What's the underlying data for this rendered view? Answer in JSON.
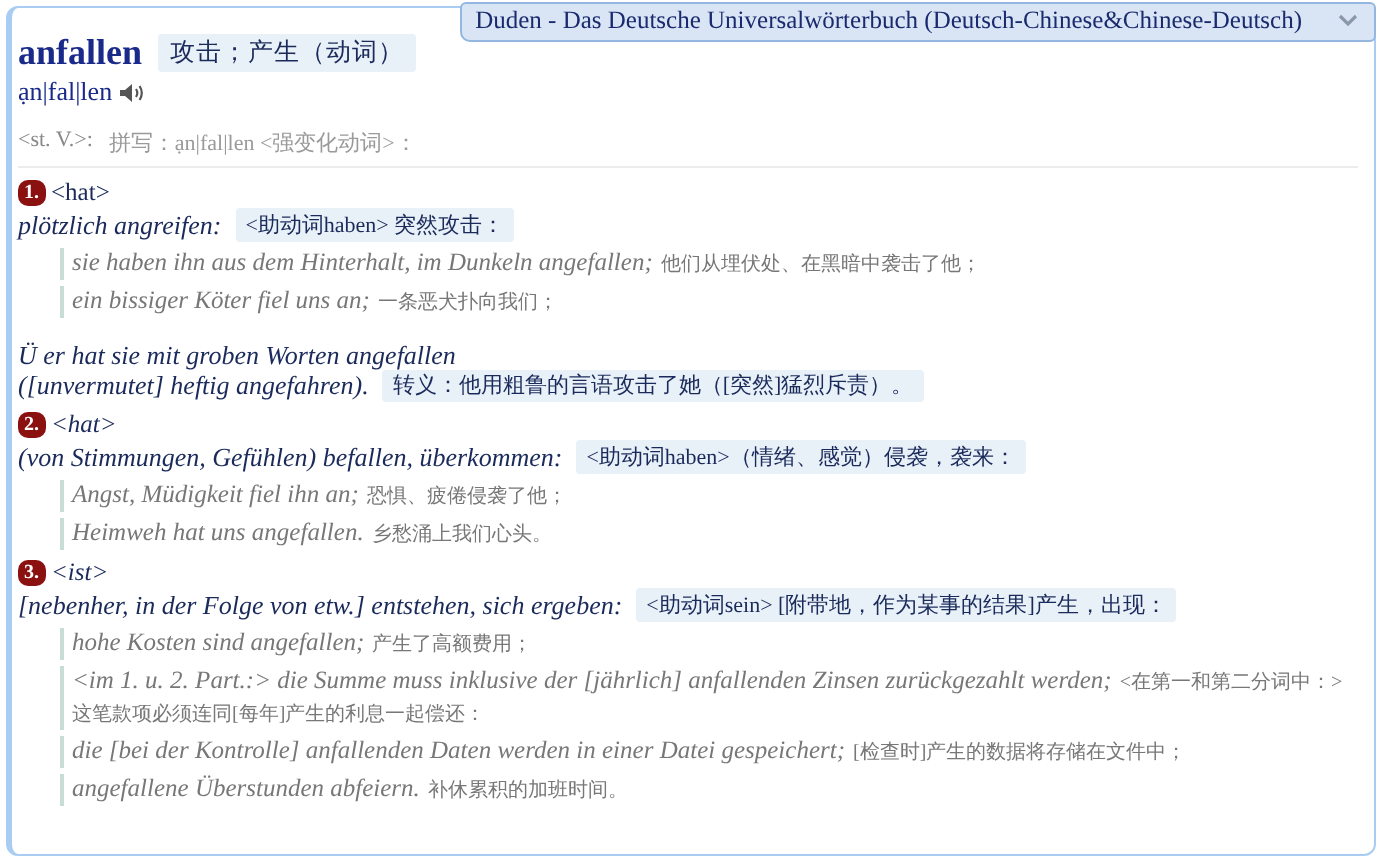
{
  "dictionary_tab": {
    "title": "Duden - Das Deutsche Universalwörterbuch (Deutsch-Chinese&Chinese-Deutsch)"
  },
  "headword": {
    "word": "anfallen",
    "translation": "攻击；产生（动词）",
    "pronunciation": "ạn|fal|len"
  },
  "grammar": {
    "label": "<st. V.>:",
    "spelling": "拼写：ạn|fal|len <强变化动词>："
  },
  "senses": [
    {
      "number": "1.",
      "aux": "<hat>",
      "definition": "plötzlich angreifen:",
      "translation": "<助动词haben> 突然攻击：",
      "examples": [
        {
          "de": "sie haben ihn aus dem Hinterhalt, im Dunkeln angefallen;",
          "zh": "他们从埋伏处、在黑暗中袭击了他；"
        },
        {
          "de": "ein bissiger Köter fiel uns an;",
          "zh": "一条恶犬扑向我们；"
        }
      ],
      "idiom": {
        "lines": [
          "Ü er hat sie mit groben Worten angefallen",
          "([unvermutet] heftig angefahren)."
        ],
        "translation": "转义：他用粗鲁的言语攻击了她（[突然]猛烈斥责）。"
      }
    },
    {
      "number": "2.",
      "aux": "<hat>",
      "definition": "(von Stimmungen, Gefühlen) befallen, überkommen:",
      "translation": "<助动词haben>（情绪、感觉）侵袭，袭来：",
      "examples": [
        {
          "de": "Angst, Müdigkeit fiel ihn an;",
          "zh": "恐惧、疲倦侵袭了他；"
        },
        {
          "de": "Heimweh hat uns angefallen.",
          "zh": "乡愁涌上我们心头。"
        }
      ]
    },
    {
      "number": "3.",
      "aux": "<ist>",
      "definition": "[nebenher, in der Folge von etw.] entstehen, sich ergeben:",
      "translation": "<助动词sein> [附带地，作为某事的结果]产生，出现：",
      "examples": [
        {
          "de": "hohe Kosten sind angefallen;",
          "zh": "产生了高额费用；"
        },
        {
          "de": "<im 1. u. 2. Part.:> die Summe muss inklusive der [jährlich] anfallenden Zinsen zurückgezahlt werden;",
          "zh": "<在第一和第二分词中：>这笔款项必须连同[每年]产生的利息一起偿还："
        },
        {
          "de": "die [bei der Kontrolle] anfallenden Daten werden in einer Datei gespeichert;",
          "zh": "[检查时]产生的数据将存储在文件中；"
        },
        {
          "de": "angefallene Überstunden abfeiern.",
          "zh": "补休累积的加班时间。"
        }
      ]
    }
  ]
}
